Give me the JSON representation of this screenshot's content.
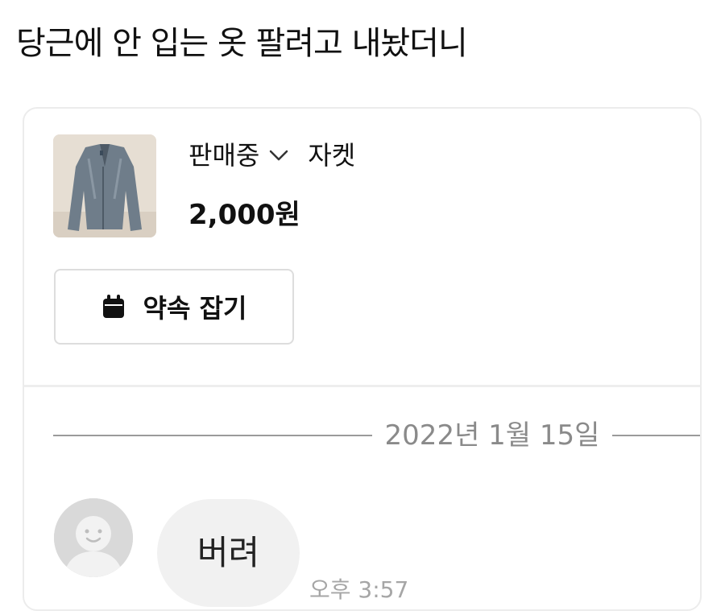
{
  "post": {
    "title": "당근에 안 입는 옷 팔려고 내놨더니"
  },
  "product": {
    "image_icon": "jacket-photo",
    "status": "판매중",
    "status_dropdown_icon": "chevron-down-icon",
    "name": "자켓",
    "price": "2,000원"
  },
  "appointment": {
    "icon": "calendar-icon",
    "label": "약속 잡기"
  },
  "chat": {
    "date": "2022년 1월 15일",
    "messages": [
      {
        "avatar_icon": "default-avatar-icon",
        "text": "버려",
        "time": "오후 3:57"
      }
    ]
  },
  "colors": {
    "card_border": "#ececec",
    "bubble_bg": "#f1f1f1",
    "muted_text": "#8a8a8a",
    "avatar_bg": "#d9d9d9"
  }
}
